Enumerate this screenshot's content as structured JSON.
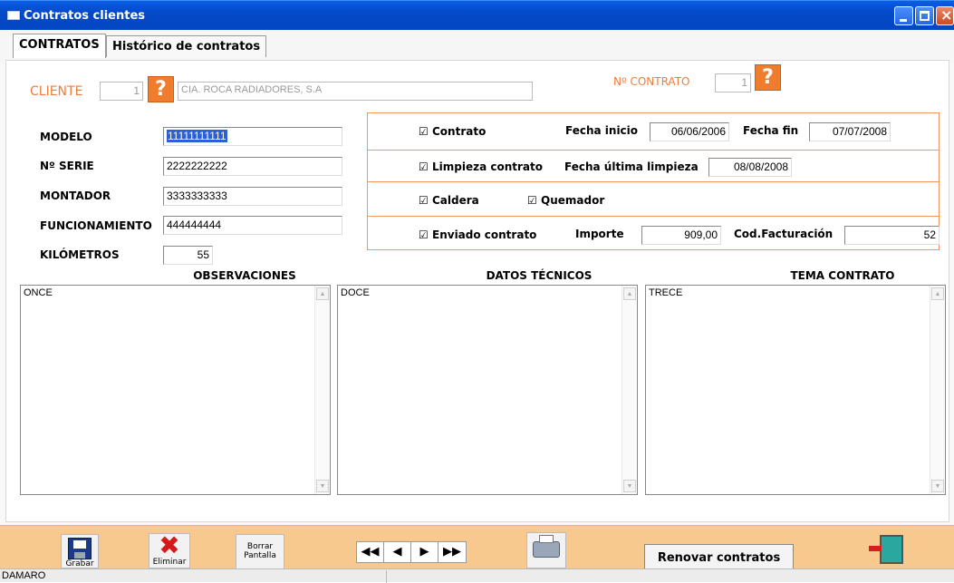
{
  "window": {
    "title": "Contratos clientes"
  },
  "tabs": [
    "CONTRATOS",
    "Histórico de contratos"
  ],
  "cliente": {
    "label": "CLIENTE",
    "id": "1",
    "name": "CIA. ROCA RADIADORES, S.A"
  },
  "contrato": {
    "label": "Nº CONTRATO",
    "value": "1"
  },
  "help_symbol": "?",
  "fields": {
    "modelo": {
      "label": "MODELO",
      "value": "11111111111"
    },
    "serie": {
      "label": "Nº SERIE",
      "value": "2222222222"
    },
    "montador": {
      "label": "MONTADOR",
      "value": "3333333333"
    },
    "funcionamiento": {
      "label": "FUNCIONAMIENTO",
      "value": "444444444"
    },
    "kilometros": {
      "label": "KILÓMETROS",
      "value": "55"
    }
  },
  "checks": {
    "contrato": "Contrato",
    "fecha_inicio_label": "Fecha inicio",
    "fecha_inicio": "06/06/2006",
    "fecha_fin_label": "Fecha fin",
    "fecha_fin": "07/07/2008",
    "limpieza": "Limpieza contrato",
    "fecha_limpieza_label": "Fecha última limpieza",
    "fecha_limpieza": "08/08/2008",
    "caldera": "Caldera",
    "quemador": "Quemador",
    "enviado": "Enviado contrato",
    "importe_label": "Importe",
    "importe": "909,00",
    "codfact_label": "Cod.Facturación",
    "codfact": "52",
    "mark": "☑"
  },
  "sections": {
    "observaciones": {
      "label": "OBSERVACIONES",
      "text": "ONCE"
    },
    "datos": {
      "label": "DATOS TÉCNICOS",
      "text": "DOCE"
    },
    "tema": {
      "label": "TEMA CONTRATO",
      "text": "TRECE"
    }
  },
  "toolbar": {
    "grabar": "Grabar",
    "eliminar": "Eliminar",
    "borrar1": "Borrar",
    "borrar2": "Pantalla",
    "nav": [
      "◀◀",
      "◀",
      "▶",
      "▶▶"
    ],
    "renovar": "Renovar contratos"
  },
  "status": {
    "left": "DAMARO"
  },
  "colors": {
    "titlebar": "#0549c8",
    "accent": "#f07c3a",
    "toolbar_bg": "#f7c98e"
  }
}
